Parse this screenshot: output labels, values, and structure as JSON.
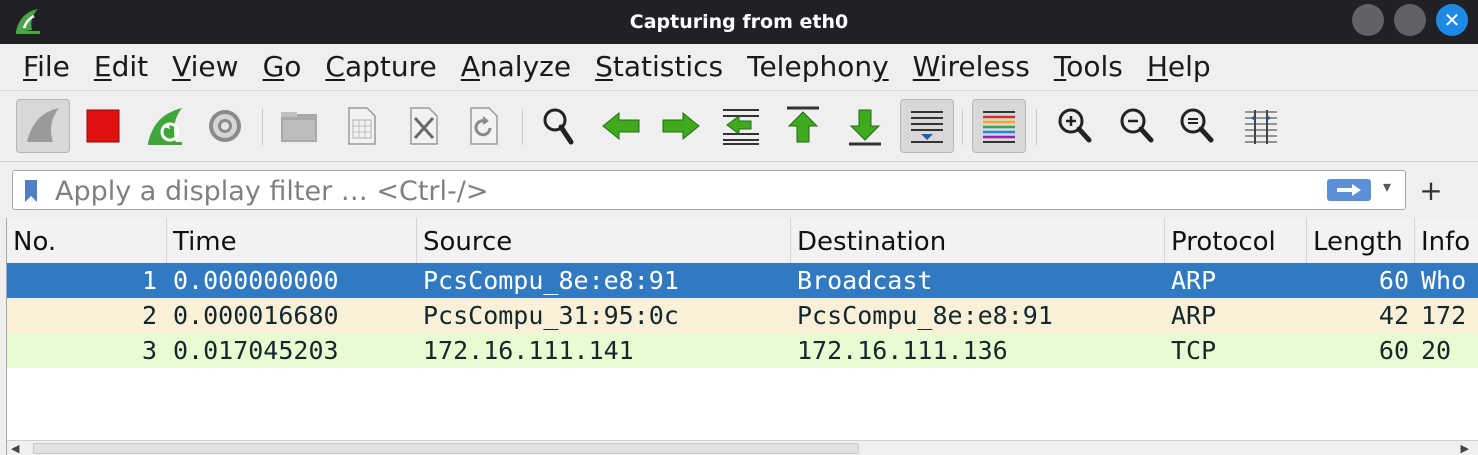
{
  "window": {
    "title": "Capturing from eth0"
  },
  "menubar": {
    "items": [
      {
        "accel": "F",
        "rest": "ile"
      },
      {
        "accel": "E",
        "rest": "dit"
      },
      {
        "accel": "V",
        "rest": "iew"
      },
      {
        "accel": "G",
        "rest": "o"
      },
      {
        "accel": "C",
        "rest": "apture"
      },
      {
        "accel": "A",
        "rest": "nalyze"
      },
      {
        "accel": "S",
        "rest": "tatistics"
      },
      {
        "pre": "Telephon",
        "accel": "y",
        "rest": ""
      },
      {
        "accel": "W",
        "rest": "ireless"
      },
      {
        "accel": "T",
        "rest": "ools"
      },
      {
        "accel": "H",
        "rest": "elp"
      }
    ]
  },
  "toolbar": {
    "icons": [
      "start-capture-fin-icon",
      "stop-capture-icon",
      "restart-capture-icon",
      "capture-options-gear-icon",
      "open-file-icon",
      "save-file-icon",
      "close-file-icon",
      "reload-file-icon",
      "find-packet-icon",
      "go-back-icon",
      "go-forward-icon",
      "go-to-packet-icon",
      "go-first-packet-icon",
      "go-last-packet-icon",
      "autoscroll-icon",
      "colorize-icon",
      "zoom-in-icon",
      "zoom-out-icon",
      "normal-size-icon",
      "resize-columns-icon"
    ],
    "colors": {
      "stop_red": "#e01010",
      "arrow_green": "#3faa1e",
      "selected_row": "#3179c0",
      "arp_row": "#faf0d7",
      "tcp_row": "#e7fcd0"
    }
  },
  "filter": {
    "placeholder": "Apply a display filter … <Ctrl-/>",
    "add_button": "+"
  },
  "packets": {
    "columns": [
      "No.",
      "Time",
      "Source",
      "Destination",
      "Protocol",
      "Length",
      "Info"
    ],
    "rows": [
      {
        "no": "1",
        "time": "0.000000000",
        "source": "PcsCompu_8e:e8:91",
        "destination": "Broadcast",
        "protocol": "ARP",
        "length": "60",
        "info": "Who"
      },
      {
        "no": "2",
        "time": "0.000016680",
        "source": "PcsCompu_31:95:0c",
        "destination": "PcsCompu_8e:e8:91",
        "protocol": "ARP",
        "length": "42",
        "info": "172"
      },
      {
        "no": "3",
        "time": "0.017045203",
        "source": "172.16.111.141",
        "destination": "172.16.111.136",
        "protocol": "TCP",
        "length": "60",
        "info": "20"
      }
    ]
  }
}
